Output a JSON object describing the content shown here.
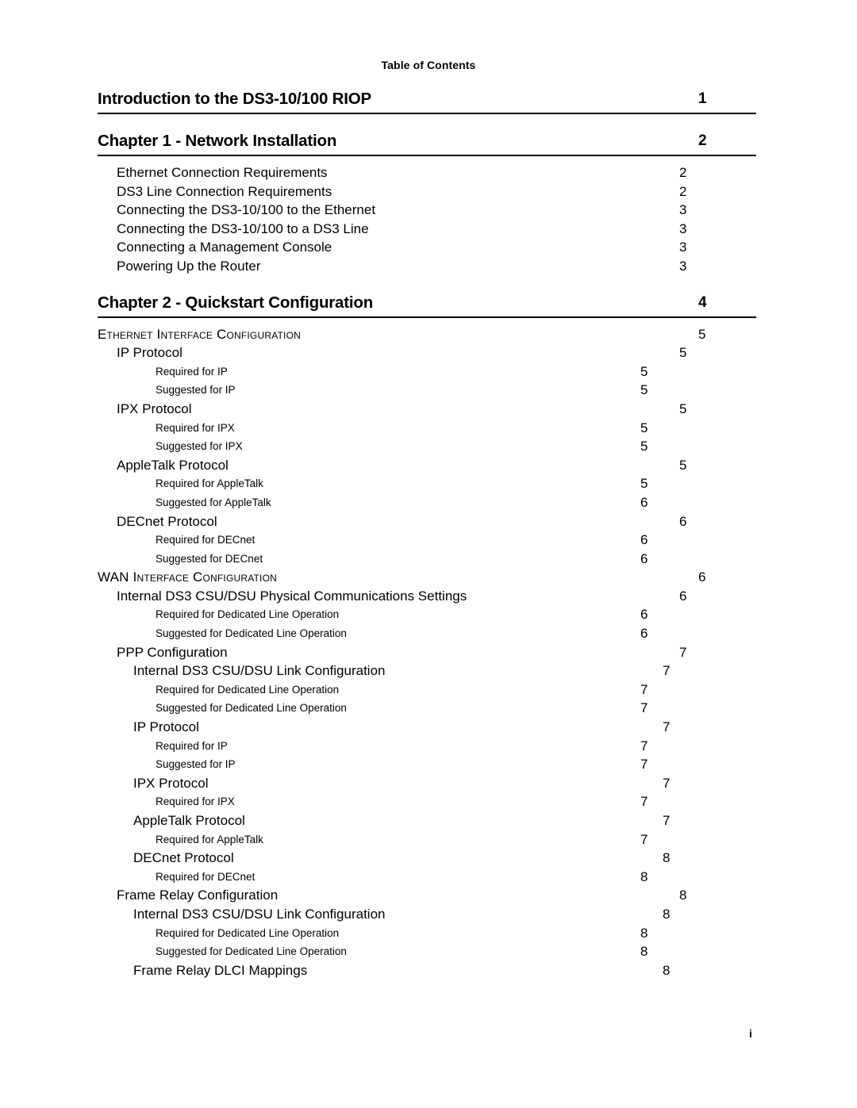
{
  "page": {
    "running_header": "Table of Contents",
    "folio": "i",
    "rule_color": "#000000"
  },
  "toc": {
    "blocks": [
      {
        "heading": {
          "title": "Introduction to the DS3-10/100 RIOP",
          "page": "1"
        },
        "entries": []
      },
      {
        "heading": {
          "title": "Chapter 1 - Network Installation",
          "page": "2"
        },
        "entries": [
          {
            "level": 1,
            "label": "Ethernet Connection Requirements",
            "page": "2"
          },
          {
            "level": 1,
            "label": "DS3 Line Connection Requirements",
            "page": "2"
          },
          {
            "level": 1,
            "label": "Connecting the DS3-10/100 to the Ethernet",
            "page": "3"
          },
          {
            "level": 1,
            "label": "Connecting the DS3-10/100 to a DS3 Line",
            "page": "3"
          },
          {
            "level": 1,
            "label": "Connecting a Management Console",
            "page": "3"
          },
          {
            "level": 1,
            "label": "Powering Up the Router",
            "page": "3"
          }
        ]
      },
      {
        "heading": {
          "title": "Chapter 2 - Quickstart Configuration",
          "page": "4"
        },
        "entries": [
          {
            "level": 0,
            "label": "Ethernet Interface Configuration",
            "page": "5"
          },
          {
            "level": 1,
            "label": "IP Protocol",
            "page": "5"
          },
          {
            "level": 3,
            "label": "Required for IP",
            "page": "5"
          },
          {
            "level": 3,
            "label": "Suggested for IP",
            "page": "5"
          },
          {
            "level": 1,
            "label": "IPX Protocol",
            "page": "5"
          },
          {
            "level": 3,
            "label": "Required for IPX",
            "page": "5"
          },
          {
            "level": 3,
            "label": "Suggested for IPX",
            "page": "5"
          },
          {
            "level": 1,
            "label": "AppleTalk Protocol",
            "page": "5"
          },
          {
            "level": 3,
            "label": "Required for AppleTalk",
            "page": "5"
          },
          {
            "level": 3,
            "label": "Suggested for AppleTalk",
            "page": "6"
          },
          {
            "level": 1,
            "label": "DECnet Protocol",
            "page": "6"
          },
          {
            "level": 3,
            "label": "Required for DECnet",
            "page": "6"
          },
          {
            "level": 3,
            "label": "Suggested for DECnet",
            "page": "6"
          },
          {
            "level": 0,
            "label": "WAN Interface Configuration",
            "page": "6",
            "acronym": "WAN"
          },
          {
            "level": 1,
            "label": "Internal DS3 CSU/DSU Physical Communications Settings",
            "page": "6"
          },
          {
            "level": 3,
            "label": "Required for Dedicated Line Operation",
            "page": "6"
          },
          {
            "level": 3,
            "label": "Suggested for Dedicated Line Operation",
            "page": "6"
          },
          {
            "level": 1,
            "label": "PPP Configuration",
            "page": "7"
          },
          {
            "level": 2,
            "label": "Internal DS3 CSU/DSU Link Configuration",
            "page": "7"
          },
          {
            "level": 3,
            "label": "Required for Dedicated Line Operation",
            "page": "7"
          },
          {
            "level": 3,
            "label": "Suggested for Dedicated Line Operation",
            "page": "7"
          },
          {
            "level": 2,
            "label": "IP Protocol",
            "page": "7"
          },
          {
            "level": 3,
            "label": "Required for IP",
            "page": "7"
          },
          {
            "level": 3,
            "label": "Suggested for IP",
            "page": "7"
          },
          {
            "level": 2,
            "label": "IPX Protocol",
            "page": "7"
          },
          {
            "level": 3,
            "label": "Required for IPX",
            "page": "7"
          },
          {
            "level": 2,
            "label": "AppleTalk Protocol",
            "page": "7"
          },
          {
            "level": 3,
            "label": "Required for AppleTalk",
            "page": "7"
          },
          {
            "level": 2,
            "label": "DECnet Protocol",
            "page": "8"
          },
          {
            "level": 3,
            "label": "Required for DECnet",
            "page": "8"
          },
          {
            "level": 1,
            "label": "Frame Relay Configuration",
            "page": "8"
          },
          {
            "level": 2,
            "label": "Internal DS3 CSU/DSU Link Configuration",
            "page": "8"
          },
          {
            "level": 3,
            "label": "Required for Dedicated Line Operation",
            "page": "8"
          },
          {
            "level": 3,
            "label": "Suggested for Dedicated Line Operation",
            "page": "8"
          },
          {
            "level": 2,
            "label": "Frame Relay DLCI Mappings",
            "page": "8"
          }
        ]
      }
    ]
  }
}
